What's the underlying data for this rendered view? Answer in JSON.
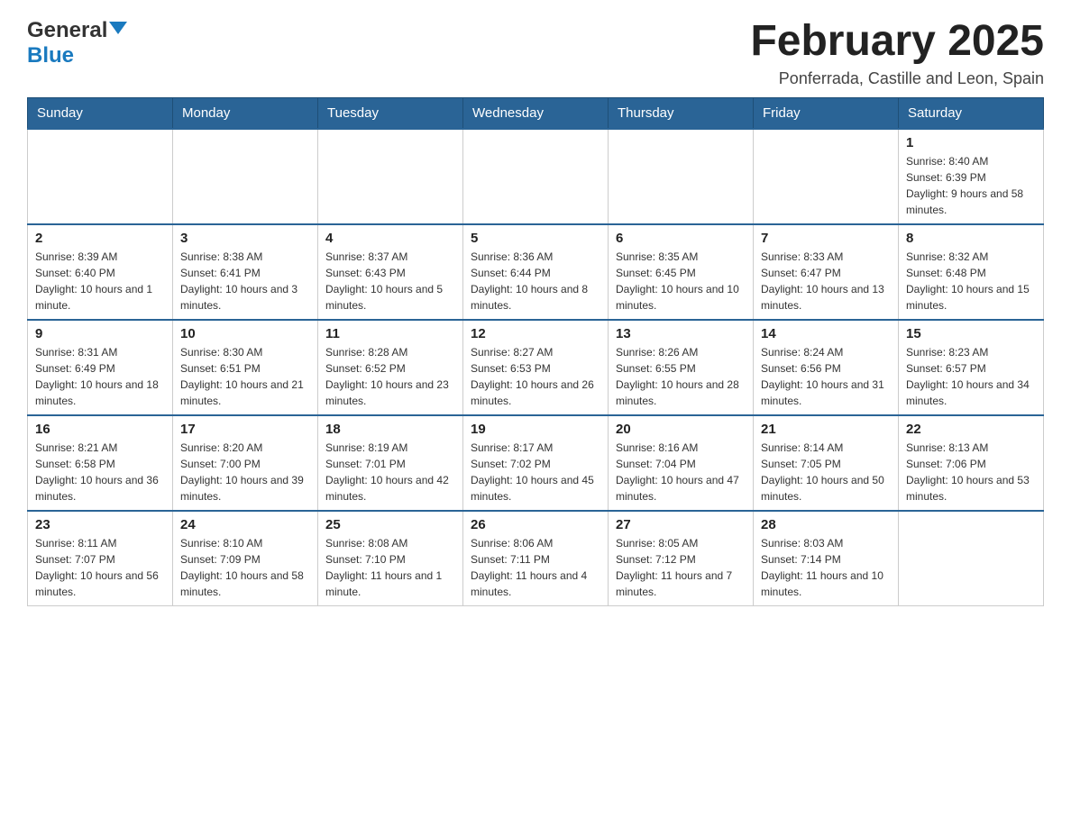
{
  "logo": {
    "general": "General",
    "blue": "Blue"
  },
  "title": "February 2025",
  "subtitle": "Ponferrada, Castille and Leon, Spain",
  "days_of_week": [
    "Sunday",
    "Monday",
    "Tuesday",
    "Wednesday",
    "Thursday",
    "Friday",
    "Saturday"
  ],
  "weeks": [
    [
      {
        "day": "",
        "info": ""
      },
      {
        "day": "",
        "info": ""
      },
      {
        "day": "",
        "info": ""
      },
      {
        "day": "",
        "info": ""
      },
      {
        "day": "",
        "info": ""
      },
      {
        "day": "",
        "info": ""
      },
      {
        "day": "1",
        "info": "Sunrise: 8:40 AM\nSunset: 6:39 PM\nDaylight: 9 hours and 58 minutes."
      }
    ],
    [
      {
        "day": "2",
        "info": "Sunrise: 8:39 AM\nSunset: 6:40 PM\nDaylight: 10 hours and 1 minute."
      },
      {
        "day": "3",
        "info": "Sunrise: 8:38 AM\nSunset: 6:41 PM\nDaylight: 10 hours and 3 minutes."
      },
      {
        "day": "4",
        "info": "Sunrise: 8:37 AM\nSunset: 6:43 PM\nDaylight: 10 hours and 5 minutes."
      },
      {
        "day": "5",
        "info": "Sunrise: 8:36 AM\nSunset: 6:44 PM\nDaylight: 10 hours and 8 minutes."
      },
      {
        "day": "6",
        "info": "Sunrise: 8:35 AM\nSunset: 6:45 PM\nDaylight: 10 hours and 10 minutes."
      },
      {
        "day": "7",
        "info": "Sunrise: 8:33 AM\nSunset: 6:47 PM\nDaylight: 10 hours and 13 minutes."
      },
      {
        "day": "8",
        "info": "Sunrise: 8:32 AM\nSunset: 6:48 PM\nDaylight: 10 hours and 15 minutes."
      }
    ],
    [
      {
        "day": "9",
        "info": "Sunrise: 8:31 AM\nSunset: 6:49 PM\nDaylight: 10 hours and 18 minutes."
      },
      {
        "day": "10",
        "info": "Sunrise: 8:30 AM\nSunset: 6:51 PM\nDaylight: 10 hours and 21 minutes."
      },
      {
        "day": "11",
        "info": "Sunrise: 8:28 AM\nSunset: 6:52 PM\nDaylight: 10 hours and 23 minutes."
      },
      {
        "day": "12",
        "info": "Sunrise: 8:27 AM\nSunset: 6:53 PM\nDaylight: 10 hours and 26 minutes."
      },
      {
        "day": "13",
        "info": "Sunrise: 8:26 AM\nSunset: 6:55 PM\nDaylight: 10 hours and 28 minutes."
      },
      {
        "day": "14",
        "info": "Sunrise: 8:24 AM\nSunset: 6:56 PM\nDaylight: 10 hours and 31 minutes."
      },
      {
        "day": "15",
        "info": "Sunrise: 8:23 AM\nSunset: 6:57 PM\nDaylight: 10 hours and 34 minutes."
      }
    ],
    [
      {
        "day": "16",
        "info": "Sunrise: 8:21 AM\nSunset: 6:58 PM\nDaylight: 10 hours and 36 minutes."
      },
      {
        "day": "17",
        "info": "Sunrise: 8:20 AM\nSunset: 7:00 PM\nDaylight: 10 hours and 39 minutes."
      },
      {
        "day": "18",
        "info": "Sunrise: 8:19 AM\nSunset: 7:01 PM\nDaylight: 10 hours and 42 minutes."
      },
      {
        "day": "19",
        "info": "Sunrise: 8:17 AM\nSunset: 7:02 PM\nDaylight: 10 hours and 45 minutes."
      },
      {
        "day": "20",
        "info": "Sunrise: 8:16 AM\nSunset: 7:04 PM\nDaylight: 10 hours and 47 minutes."
      },
      {
        "day": "21",
        "info": "Sunrise: 8:14 AM\nSunset: 7:05 PM\nDaylight: 10 hours and 50 minutes."
      },
      {
        "day": "22",
        "info": "Sunrise: 8:13 AM\nSunset: 7:06 PM\nDaylight: 10 hours and 53 minutes."
      }
    ],
    [
      {
        "day": "23",
        "info": "Sunrise: 8:11 AM\nSunset: 7:07 PM\nDaylight: 10 hours and 56 minutes."
      },
      {
        "day": "24",
        "info": "Sunrise: 8:10 AM\nSunset: 7:09 PM\nDaylight: 10 hours and 58 minutes."
      },
      {
        "day": "25",
        "info": "Sunrise: 8:08 AM\nSunset: 7:10 PM\nDaylight: 11 hours and 1 minute."
      },
      {
        "day": "26",
        "info": "Sunrise: 8:06 AM\nSunset: 7:11 PM\nDaylight: 11 hours and 4 minutes."
      },
      {
        "day": "27",
        "info": "Sunrise: 8:05 AM\nSunset: 7:12 PM\nDaylight: 11 hours and 7 minutes."
      },
      {
        "day": "28",
        "info": "Sunrise: 8:03 AM\nSunset: 7:14 PM\nDaylight: 11 hours and 10 minutes."
      },
      {
        "day": "",
        "info": ""
      }
    ]
  ]
}
